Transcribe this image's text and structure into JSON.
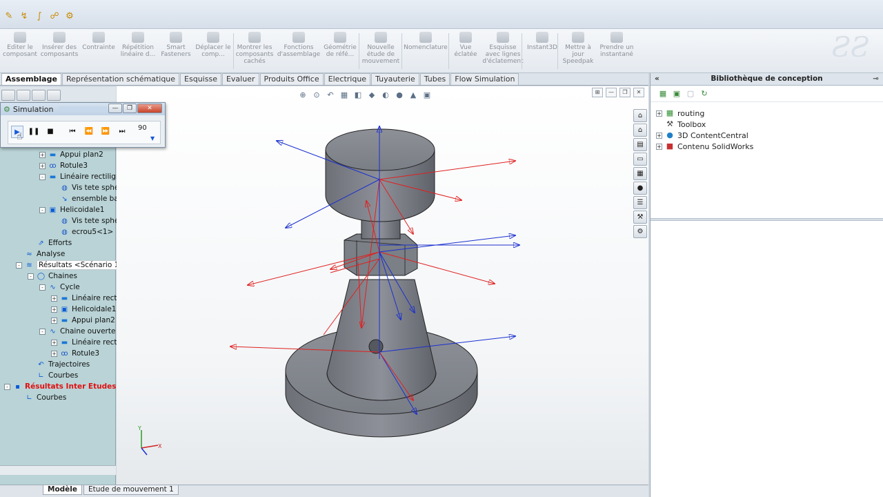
{
  "ribbon": {
    "buttons": [
      "Editer le composant",
      "Insérer des composants",
      "Contrainte",
      "Répétition linéaire d...",
      "Smart Fasteners",
      "Déplacer le comp...",
      "Montrer les composants cachés",
      "Fonctions d'assemblage",
      "Géométrie de réfé...",
      "Nouvelle étude de mouvement",
      "Nomenclature",
      "Vue éclatée",
      "Esquisse avec lignes d'éclatement",
      "Instant3D",
      "Mettre à jour Speedpak",
      "Prendre un instantané"
    ]
  },
  "tabs": [
    "Assemblage",
    "Représentation schématique",
    "Esquisse",
    "Evaluer",
    "Produits Office",
    "Electrique",
    "Tuyauterie",
    "Tubes",
    "Flow Simulation"
  ],
  "simulation": {
    "title": "Simulation",
    "frame": "90"
  },
  "tree": [
    {
      "label": "Appui plan2",
      "icon": "line",
      "indent": 1,
      "expander": "+"
    },
    {
      "label": "Rotule3",
      "icon": "ball",
      "indent": 1,
      "expander": "+"
    },
    {
      "label": "Linéaire rectilign",
      "icon": "line",
      "indent": 1,
      "expander": "-"
    },
    {
      "label": "Vis tete sphér",
      "icon": "part",
      "indent": 2,
      "expander": ""
    },
    {
      "label": "ensemble bat",
      "icon": "assy",
      "indent": 2,
      "expander": ""
    },
    {
      "label": "Helicoidale1",
      "icon": "helix",
      "indent": 1,
      "expander": "-"
    },
    {
      "label": "Vis tete sphér",
      "icon": "part",
      "indent": 2,
      "expander": ""
    },
    {
      "label": "ecrou5<1>",
      "icon": "part",
      "indent": 2,
      "expander": ""
    },
    {
      "label": "Efforts",
      "icon": "force",
      "indent": 0,
      "expander": ""
    },
    {
      "label": "Analyse",
      "icon": "analysis",
      "indent": -1,
      "expander": ""
    },
    {
      "label": "Résultats <Scénario 1>",
      "icon": "results",
      "indent": -1,
      "expander": "-",
      "highlight": true
    },
    {
      "label": "Chaines",
      "icon": "chain",
      "indent": 0,
      "expander": "-"
    },
    {
      "label": "Cycle",
      "icon": "cycle",
      "indent": 1,
      "expander": "-"
    },
    {
      "label": "Linéaire rectil",
      "icon": "line",
      "indent": 2,
      "expander": "+"
    },
    {
      "label": "Helicoidale1",
      "icon": "helix",
      "indent": 2,
      "expander": "+"
    },
    {
      "label": "Appui plan2",
      "icon": "line",
      "indent": 2,
      "expander": "+"
    },
    {
      "label": "Chaine ouverte",
      "icon": "cycle",
      "indent": 1,
      "expander": "-"
    },
    {
      "label": "Linéaire rectil",
      "icon": "line",
      "indent": 2,
      "expander": "+"
    },
    {
      "label": "Rotule3",
      "icon": "ball",
      "indent": 2,
      "expander": "+"
    },
    {
      "label": "Trajectoires",
      "icon": "traj",
      "indent": 0,
      "expander": ""
    },
    {
      "label": "Courbes",
      "icon": "curve",
      "indent": 0,
      "expander": ""
    },
    {
      "label": "Résultats Inter Etudes",
      "icon": "inter",
      "indent": -2,
      "expander": "-",
      "red": true
    },
    {
      "label": "Courbes",
      "icon": "curve",
      "indent": -1,
      "expander": ""
    }
  ],
  "bottom_tabs": [
    "Modèle",
    "Etude de mouvement 1"
  ],
  "library": {
    "title": "Bibliothèque de conception",
    "items": [
      {
        "label": "routing",
        "expander": "+",
        "icon": "folder-green"
      },
      {
        "label": "Toolbox",
        "expander": "",
        "icon": "toolbox"
      },
      {
        "label": "3D ContentCentral",
        "expander": "+",
        "icon": "globe"
      },
      {
        "label": "Contenu SolidWorks",
        "expander": "+",
        "icon": "cube-red"
      }
    ]
  },
  "axis": {
    "x": "X",
    "y": "Y"
  },
  "colors": {
    "accent": "#1b58d8",
    "red_force": "#e02020",
    "blue_force": "#1a2fd0",
    "part": "#7c8088"
  }
}
